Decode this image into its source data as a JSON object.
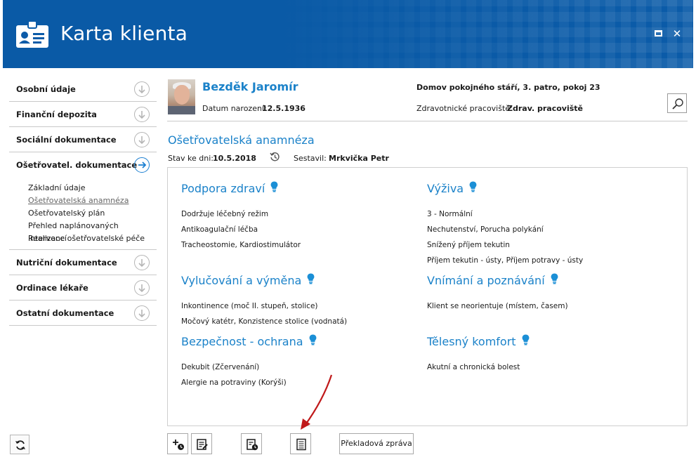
{
  "window": {
    "title": "Karta klienta",
    "accent_color": "#0b5ba8"
  },
  "sidebar": {
    "items": [
      {
        "label": "Osobní údaje",
        "icon": "arrow-down-circle-icon"
      },
      {
        "label": "Finanční depozita",
        "icon": "arrow-down-circle-icon"
      },
      {
        "label": "Sociální dokumentace",
        "icon": "arrow-down-circle-icon"
      },
      {
        "label": "Ošetřovatel. dokumentace",
        "icon": "arrow-right-circle-icon",
        "active": true
      },
      {
        "label": "Nutriční dokumentace",
        "icon": "arrow-down-circle-icon"
      },
      {
        "label": "Ordinace lékaře",
        "icon": "arrow-down-circle-icon"
      },
      {
        "label": "Ostatní dokumentace",
        "icon": "arrow-down-circle-icon"
      }
    ],
    "subitems": [
      {
        "label": "Základní údaje"
      },
      {
        "label": "Ošetřovatelská anamnéza",
        "current": true
      },
      {
        "label": "Ošetřovatelský plán"
      },
      {
        "label": "Přehled naplánovaných intervencí"
      },
      {
        "label": "Realizace ošetřovatelské péče"
      }
    ]
  },
  "patient": {
    "name": "Bezděk Jaromír",
    "dob_label": "Datum narození:",
    "dob": "12.5.1936",
    "facility": "Domov pokojného stáří, 3. patro, pokoj 23",
    "workplace_label": "Zdravotnické pracoviště:",
    "workplace": "Zdrav. pracoviště"
  },
  "document": {
    "title": "Ošetřovatelská anamnéza",
    "state_label": "Stav ke dni:",
    "state_date": "10.5.2018",
    "author_label": "Sestavil:",
    "author": "Mrkvička Petr"
  },
  "categories": [
    {
      "title": "Podpora zdraví",
      "lines": [
        "Dodržuje léčebný režim",
        "Antikoagulační léčba",
        "Tracheostomie, Kardiostimulátor"
      ]
    },
    {
      "title": "Výživa",
      "lines": [
        "3 - Normální",
        "Nechutenství, Porucha polykání",
        "Snížený příjem tekutin",
        "Příjem tekutin - ústy, Příjem potravy - ústy"
      ]
    },
    {
      "title": "Vylučování a výměna",
      "lines": [
        "Inkontinence (moč II. stupeň, stolice)",
        "Močový katétr, Konzistence stolice (vodnatá)"
      ]
    },
    {
      "title": "Vnímání a poznávání",
      "lines": [
        "Klient se neorientuje (místem, časem)"
      ]
    },
    {
      "title": "Bezpečnost - ochrana",
      "lines": [
        "Dekubit (Zčervenání)",
        "Alergie na potraviny (Korýši)"
      ]
    },
    {
      "title": "Tělesný komfort",
      "lines": [
        "Akutní a chronická bolest"
      ]
    }
  ],
  "toolbar": {
    "report_button_label": "Překladová zpráva"
  }
}
